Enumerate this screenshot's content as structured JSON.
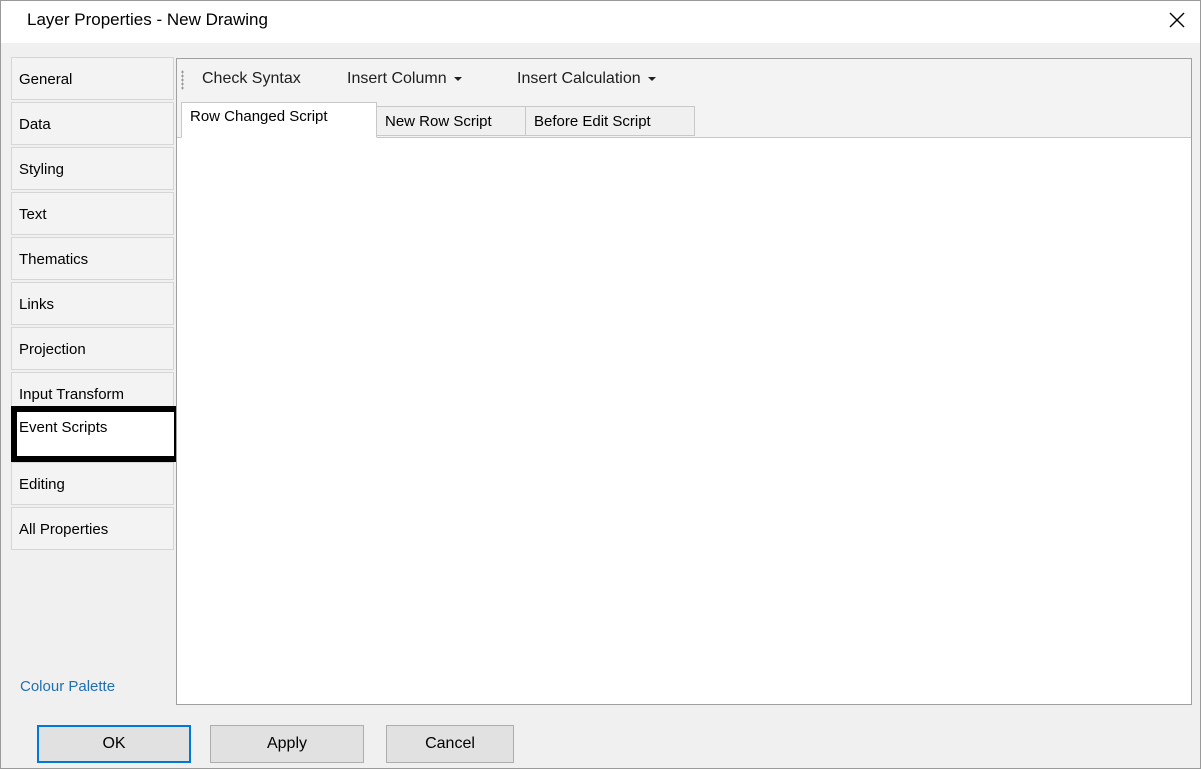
{
  "window": {
    "title": "Layer Properties - New Drawing",
    "close_icon": "close-icon"
  },
  "nav": {
    "items": [
      {
        "label": "General"
      },
      {
        "label": "Data"
      },
      {
        "label": "Styling"
      },
      {
        "label": "Text"
      },
      {
        "label": "Thematics"
      },
      {
        "label": "Links"
      },
      {
        "label": "Projection"
      },
      {
        "label": "Input Transform"
      },
      {
        "label": "Event Scripts"
      },
      {
        "label": "Editing"
      },
      {
        "label": "All Properties"
      }
    ],
    "selected": "Event Scripts",
    "palette_link": "Colour Palette"
  },
  "toolbar": {
    "check_syntax": "Check Syntax",
    "insert_column": "Insert Column",
    "insert_calculation": "Insert Calculation"
  },
  "tabs": [
    {
      "label": "Row Changed Script"
    },
    {
      "label": "New Row Script"
    },
    {
      "label": "Before Edit Script"
    }
  ],
  "active_tab": "Row Changed Script",
  "editor": {
    "value": ""
  },
  "buttons": {
    "ok": "OK",
    "apply": "Apply",
    "cancel": "Cancel"
  },
  "colors": {
    "link": "#1f6fb2",
    "default_button_border": "#0078d7",
    "selection_outline": "#000000"
  }
}
